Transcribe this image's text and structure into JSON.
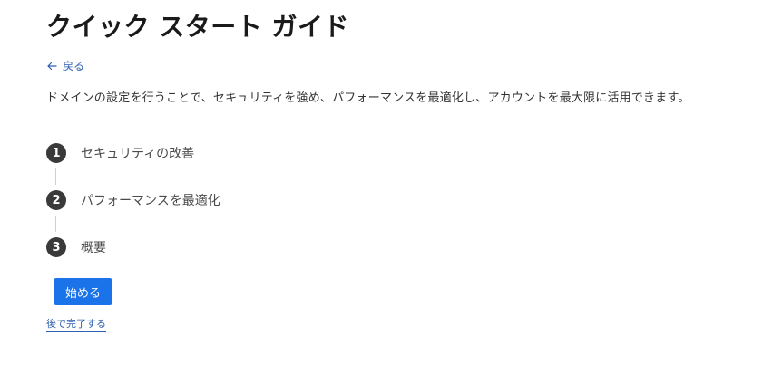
{
  "header": {
    "title": "クイック スタート ガイド"
  },
  "nav": {
    "back_label": "戻る",
    "back_icon": "arrow-left-icon"
  },
  "intro": {
    "description": "ドメインの設定を行うことで、セキュリティを強め、パフォーマンスを最適化し、アカウントを最大限に活用できます。"
  },
  "steps": [
    {
      "number": "1",
      "label": "セキュリティの改善"
    },
    {
      "number": "2",
      "label": "パフォーマンスを最適化"
    },
    {
      "number": "3",
      "label": "概要"
    }
  ],
  "actions": {
    "start_label": "始める",
    "later_label": "後で完了する"
  },
  "colors": {
    "accent": "#1a73e8",
    "link": "#2f5fb0",
    "step_circle": "#3a3a3a"
  }
}
